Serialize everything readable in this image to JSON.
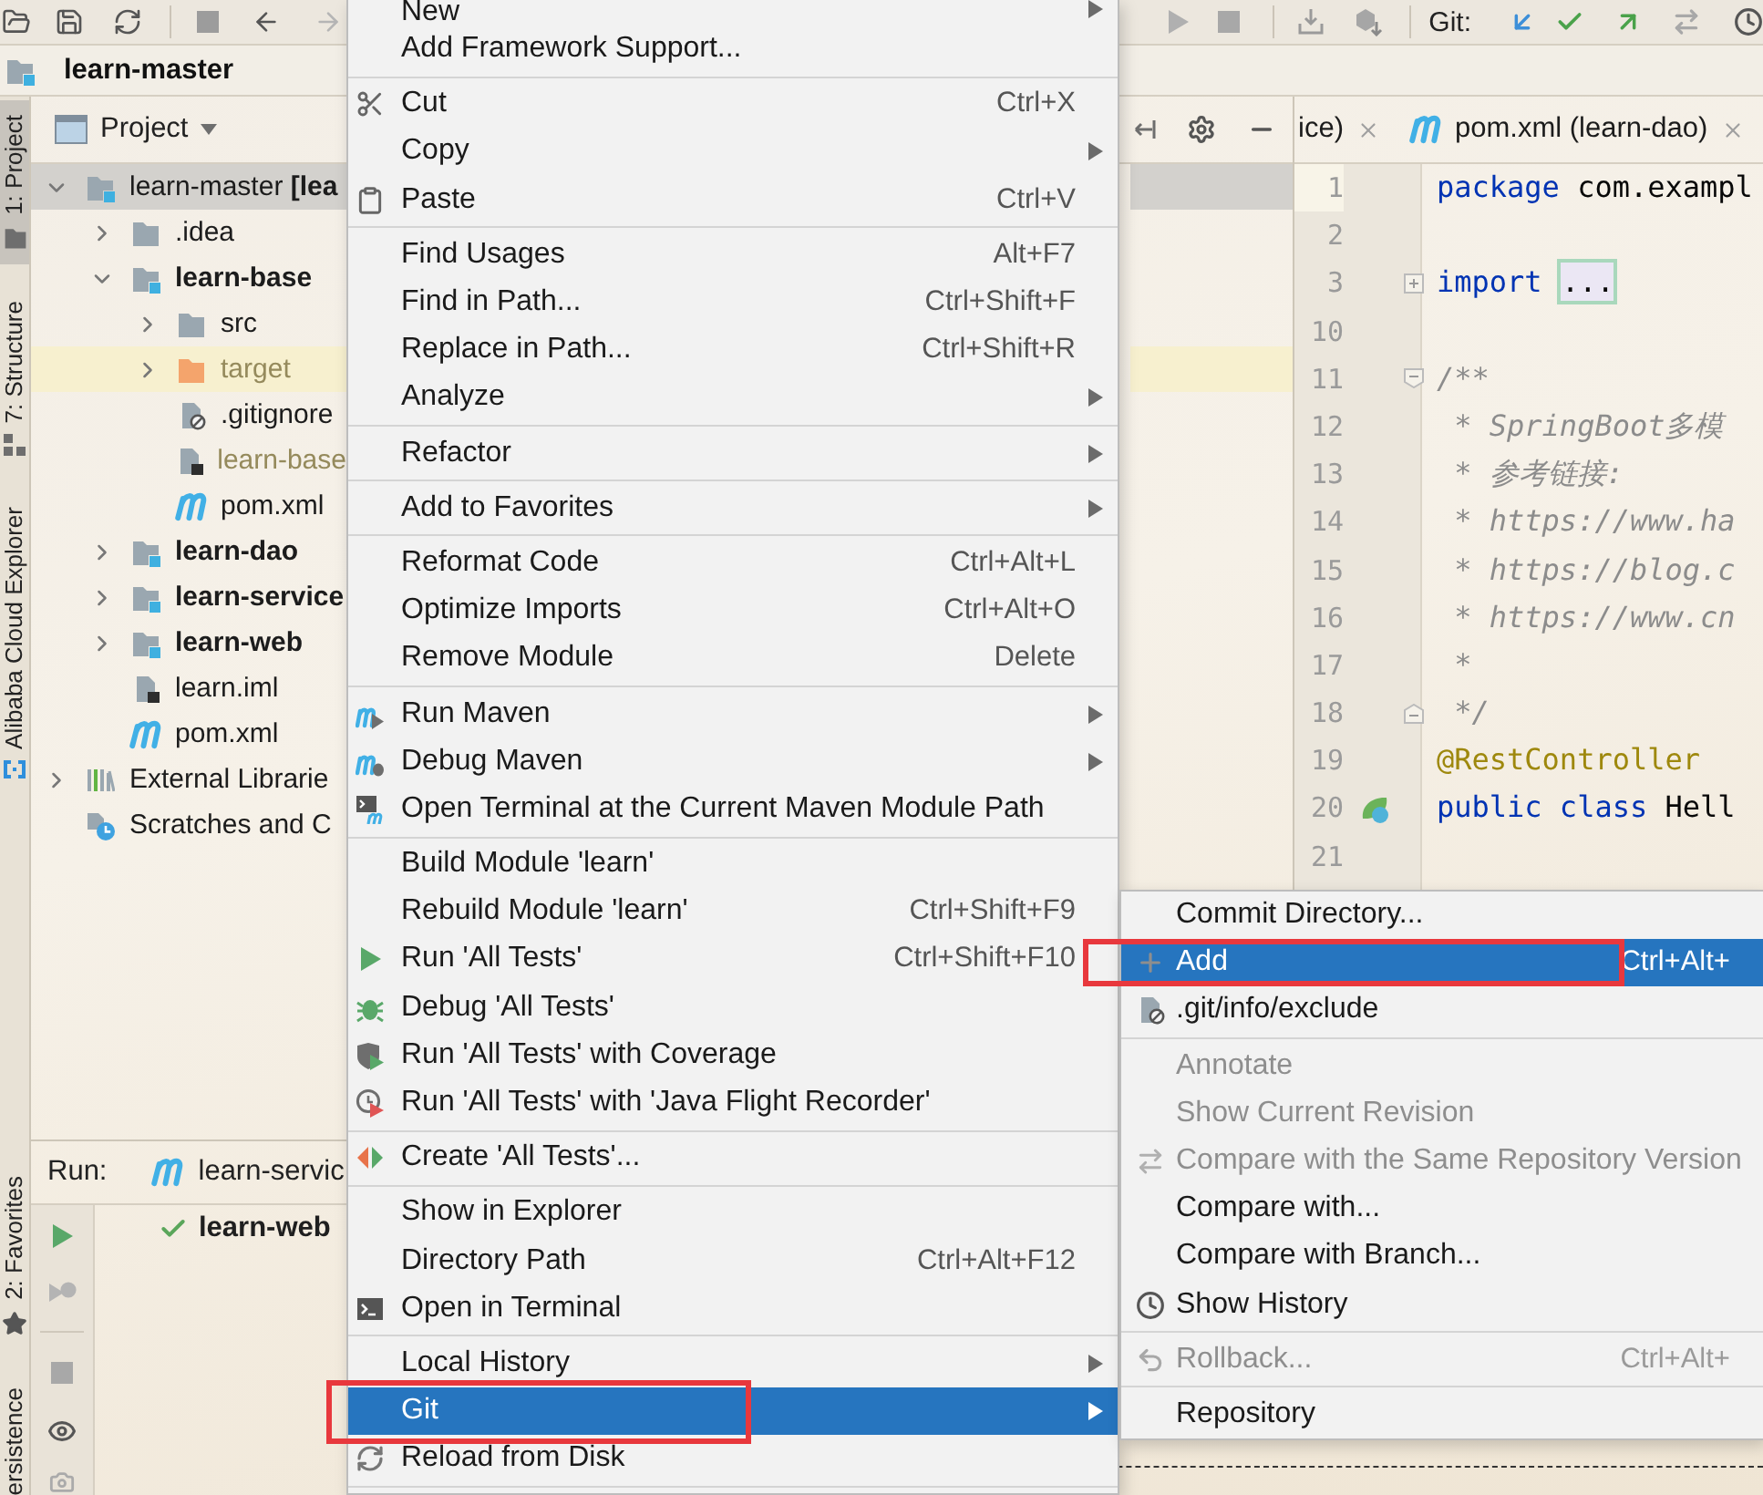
{
  "toolbar": {
    "git_label": "Git:"
  },
  "breadcrumb": {
    "label": "learn-master"
  },
  "tool_strip": {
    "top": [
      {
        "label": "1: Project",
        "selected": true
      },
      {
        "label": "7: Structure",
        "selected": false
      },
      {
        "label": "Alibaba Cloud Explorer",
        "selected": false
      }
    ],
    "bottom": [
      {
        "label": "2: Favorites",
        "selected": false
      },
      {
        "label": "ersistence",
        "selected": false
      }
    ]
  },
  "project_panel": {
    "title": "Project",
    "tree": [
      {
        "label": "learn-master **[lea**",
        "kind": "root",
        "expanded": true,
        "selected": true,
        "highlighted": false,
        "ignored": false,
        "children": [
          {
            "label": ".idea",
            "kind": "folder",
            "expanded": false,
            "selected": false,
            "highlighted": false,
            "ignored": false
          },
          {
            "label": "learn-base",
            "kind": "module",
            "expanded": true,
            "selected": false,
            "highlighted": false,
            "ignored": false,
            "children": [
              {
                "label": "src",
                "kind": "folder",
                "expanded": false,
                "selected": false,
                "highlighted": false,
                "ignored": false
              },
              {
                "label": "target",
                "kind": "excluded",
                "expanded": false,
                "selected": false,
                "highlighted": true,
                "ignored": true
              },
              {
                "label": ".gitignore",
                "kind": "ignore-file",
                "selected": false,
                "highlighted": false,
                "ignored": false
              },
              {
                "label": "learn-base",
                "kind": "iml-file",
                "selected": false,
                "highlighted": false,
                "ignored": true
              },
              {
                "label": "pom.xml",
                "kind": "maven",
                "selected": false,
                "highlighted": false,
                "ignored": false
              }
            ]
          },
          {
            "label": "learn-dao",
            "kind": "module",
            "expanded": false,
            "selected": false,
            "highlighted": false,
            "ignored": false
          },
          {
            "label": "learn-service",
            "kind": "module",
            "expanded": false,
            "selected": false,
            "highlighted": false,
            "ignored": false
          },
          {
            "label": "learn-web",
            "kind": "module",
            "expanded": false,
            "selected": false,
            "highlighted": false,
            "ignored": false
          },
          {
            "label": "learn.iml",
            "kind": "iml-file",
            "selected": false,
            "highlighted": false,
            "ignored": false
          },
          {
            "label": "pom.xml",
            "kind": "maven",
            "selected": false,
            "highlighted": false,
            "ignored": false
          }
        ]
      },
      {
        "label": "External Librarie",
        "kind": "libraries",
        "expanded": false,
        "selected": false,
        "highlighted": false,
        "ignored": false
      },
      {
        "label": "Scratches and C",
        "kind": "scratches",
        "selected": false,
        "highlighted": false,
        "ignored": false
      }
    ]
  },
  "editor": {
    "tabs": [
      {
        "label": "ice)",
        "kind": "plain",
        "selected": false
      },
      {
        "label": "pom.xml (learn-dao)",
        "kind": "maven",
        "selected": false
      }
    ],
    "lines": [
      {
        "number": "1",
        "kind": "plain",
        "current": true,
        "code": [
          {
            "text": "package",
            "kind": "keyword"
          },
          {
            "text": " com.exampl",
            "kind": "plain"
          }
        ]
      },
      {
        "number": "2",
        "kind": "plain",
        "current": false
      },
      {
        "number": "3",
        "kind": "fold-collapsed",
        "current": false,
        "code": [
          {
            "text": "import ",
            "kind": "keyword"
          },
          {
            "text": "...",
            "kind": "folded"
          }
        ]
      },
      {
        "number": "10",
        "kind": "plain",
        "current": false
      },
      {
        "number": "11",
        "kind": "fold-start",
        "current": false,
        "code": [
          {
            "text": "/**",
            "kind": "comment"
          }
        ]
      },
      {
        "number": "12",
        "kind": "plain",
        "current": false,
        "code": [
          {
            "text": " * SpringBoot多模",
            "kind": "comment"
          }
        ]
      },
      {
        "number": "13",
        "kind": "plain",
        "current": false,
        "code": [
          {
            "text": " * 参考链接:",
            "kind": "comment"
          }
        ]
      },
      {
        "number": "14",
        "kind": "plain",
        "current": false,
        "code": [
          {
            "text": " * https://www.ha",
            "kind": "comment"
          }
        ]
      },
      {
        "number": "15",
        "kind": "plain",
        "current": false,
        "code": [
          {
            "text": " * https://blog.c",
            "kind": "comment"
          }
        ]
      },
      {
        "number": "16",
        "kind": "plain",
        "current": false,
        "code": [
          {
            "text": " * https://www.cn",
            "kind": "comment"
          }
        ]
      },
      {
        "number": "17",
        "kind": "plain",
        "current": false,
        "code": [
          {
            "text": " *",
            "kind": "comment"
          }
        ]
      },
      {
        "number": "18",
        "kind": "fold-end",
        "current": false,
        "code": [
          {
            "text": " */",
            "kind": "comment"
          }
        ]
      },
      {
        "number": "19",
        "kind": "plain",
        "current": false,
        "code": [
          {
            "text": "@RestController",
            "kind": "annotation"
          }
        ]
      },
      {
        "number": "20",
        "kind": "plain",
        "current": false,
        "gutter_icon": true,
        "code": [
          {
            "text": "public class",
            "kind": "keyword"
          },
          {
            "text": " Hell",
            "kind": "plain"
          }
        ]
      },
      {
        "number": "21",
        "kind": "plain",
        "current": false
      }
    ]
  },
  "run_panel": {
    "title": "Run:",
    "tab": "learn-servic",
    "results": [
      {
        "label": "learn-web",
        "passed": true
      }
    ]
  },
  "context_menu": {
    "groups": [
      [
        {
          "label": "New",
          "arrow": true,
          "selected": false
        },
        {
          "label": "Add Framework Support...",
          "selected": false
        }
      ],
      [
        {
          "label": "Cut",
          "shortcut": "Ctrl+X",
          "selected": false
        },
        {
          "label": "Copy",
          "arrow": true,
          "selected": false
        },
        {
          "label": "Paste",
          "shortcut": "Ctrl+V",
          "selected": false
        }
      ],
      [
        {
          "label": "Find Usages",
          "shortcut": "Alt+F7",
          "selected": false
        },
        {
          "label": "Find in Path...",
          "shortcut": "Ctrl+Shift+F",
          "selected": false
        },
        {
          "label": "Replace in Path...",
          "shortcut": "Ctrl+Shift+R",
          "selected": false
        },
        {
          "label": "Analyze",
          "arrow": true,
          "selected": false
        }
      ],
      [
        {
          "label": "Refactor",
          "arrow": true,
          "selected": false
        }
      ],
      [
        {
          "label": "Add to Favorites",
          "arrow": true,
          "selected": false
        }
      ],
      [
        {
          "label": "Reformat Code",
          "shortcut": "Ctrl+Alt+L",
          "selected": false
        },
        {
          "label": "Optimize Imports",
          "shortcut": "Ctrl+Alt+O",
          "selected": false
        },
        {
          "label": "Remove Module",
          "shortcut": "Delete",
          "selected": false
        }
      ],
      [
        {
          "label": "Run Maven",
          "arrow": true,
          "selected": false
        },
        {
          "label": "Debug Maven",
          "arrow": true,
          "selected": false
        },
        {
          "label": "Open Terminal at the Current Maven Module Path",
          "selected": false
        }
      ],
      [
        {
          "label": "Build Module 'learn'",
          "selected": false
        },
        {
          "label": "Rebuild Module 'learn'",
          "shortcut": "Ctrl+Shift+F9",
          "selected": false
        },
        {
          "label": "Run 'All Tests'",
          "shortcut": "Ctrl+Shift+F10",
          "selected": false
        },
        {
          "label": "Debug 'All Tests'",
          "selected": false
        },
        {
          "label": "Run 'All Tests' with Coverage",
          "selected": false
        },
        {
          "label": "Run 'All Tests' with 'Java Flight Recorder'",
          "selected": false
        }
      ],
      [
        {
          "label": "Create 'All Tests'...",
          "selected": false
        }
      ],
      [
        {
          "label": "Show in Explorer",
          "selected": false
        },
        {
          "label": "Directory Path",
          "shortcut": "Ctrl+Alt+F12",
          "selected": false
        },
        {
          "label": "Open in Terminal",
          "selected": false
        }
      ],
      [
        {
          "label": "Local History",
          "arrow": true,
          "selected": false
        },
        {
          "label": "Git",
          "arrow": true,
          "selected": true
        },
        {
          "label": "Reload from Disk",
          "selected": false
        }
      ]
    ]
  },
  "git_submenu": {
    "groups": [
      [
        {
          "label": "Commit Directory...",
          "selected": false,
          "disabled": false
        },
        {
          "label": "Add",
          "shortcut": "Ctrl+Alt+",
          "selected": true,
          "disabled": false
        },
        {
          "label": ".git/info/exclude",
          "selected": false,
          "disabled": false
        }
      ],
      [
        {
          "label": "Annotate",
          "selected": false,
          "disabled": true
        },
        {
          "label": "Show Current Revision",
          "selected": false,
          "disabled": true
        },
        {
          "label": "Compare with the Same Repository Version",
          "selected": false,
          "disabled": true
        },
        {
          "label": "Compare with...",
          "selected": false,
          "disabled": false
        },
        {
          "label": "Compare with Branch...",
          "selected": false,
          "disabled": false
        },
        {
          "label": "Show History",
          "selected": false,
          "disabled": false
        }
      ],
      [
        {
          "label": "Rollback...",
          "shortcut": "Ctrl+Alt+",
          "selected": false,
          "disabled": true
        }
      ],
      [
        {
          "label": "Repository",
          "selected": false,
          "disabled": false
        }
      ]
    ]
  }
}
